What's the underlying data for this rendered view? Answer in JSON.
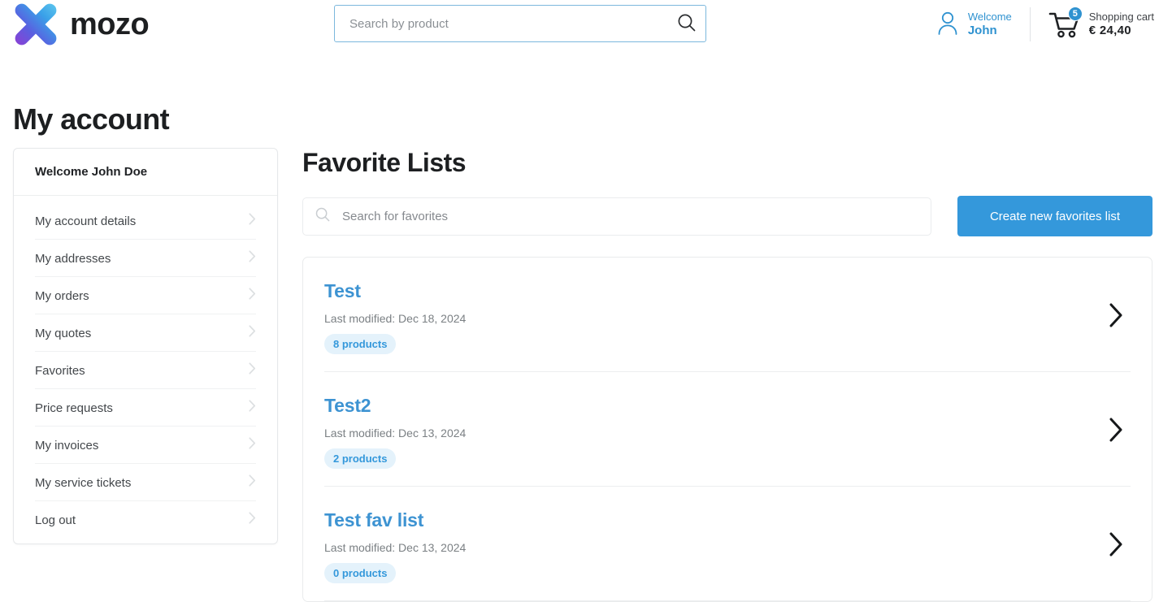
{
  "header": {
    "brand_name": "mozo",
    "logo_icon": "mozo-x-logo",
    "search": {
      "placeholder": "Search by product",
      "value": "",
      "icon": "search-icon"
    },
    "account": {
      "icon": "user-icon",
      "welcome_label": "Welcome",
      "user_name": "John"
    },
    "cart": {
      "icon": "shopping-cart-icon",
      "badge_count": "5",
      "label": "Shopping cart",
      "total": "€  24,40"
    }
  },
  "page": {
    "title": "My account"
  },
  "sidebar": {
    "welcome": "Welcome John Doe",
    "items": [
      {
        "label": "My account details",
        "icon": "chevron-right-icon"
      },
      {
        "label": "My addresses",
        "icon": "chevron-right-icon"
      },
      {
        "label": "My orders",
        "icon": "chevron-right-icon"
      },
      {
        "label": "My quotes",
        "icon": "chevron-right-icon"
      },
      {
        "label": "Favorites",
        "icon": "chevron-right-icon"
      },
      {
        "label": "Price requests",
        "icon": "chevron-right-icon"
      },
      {
        "label": "My invoices",
        "icon": "chevron-right-icon"
      },
      {
        "label": "My service tickets",
        "icon": "chevron-right-icon"
      },
      {
        "label": "Log out",
        "icon": "chevron-right-icon"
      }
    ]
  },
  "main": {
    "title": "Favorite Lists",
    "search": {
      "placeholder": "Search for favorites",
      "value": "",
      "icon": "search-icon"
    },
    "create_button": "Create new favorites list",
    "lists": [
      {
        "name": "Test",
        "modified": "Last modified: Dec 18, 2024",
        "products": "8 products",
        "chevron": "chevron-right-icon"
      },
      {
        "name": "Test2",
        "modified": "Last modified: Dec 13, 2024",
        "products": "2 products",
        "chevron": "chevron-right-icon"
      },
      {
        "name": "Test fav list",
        "modified": "Last modified: Dec 13, 2024",
        "products": "0 products",
        "chevron": "chevron-right-icon"
      }
    ]
  },
  "colors": {
    "accent_blue": "#3498db",
    "link_blue": "#3d93d2",
    "badge_bg": "#e4f2fb",
    "text_dark": "#1d1f21",
    "text_muted": "#7b8084"
  }
}
